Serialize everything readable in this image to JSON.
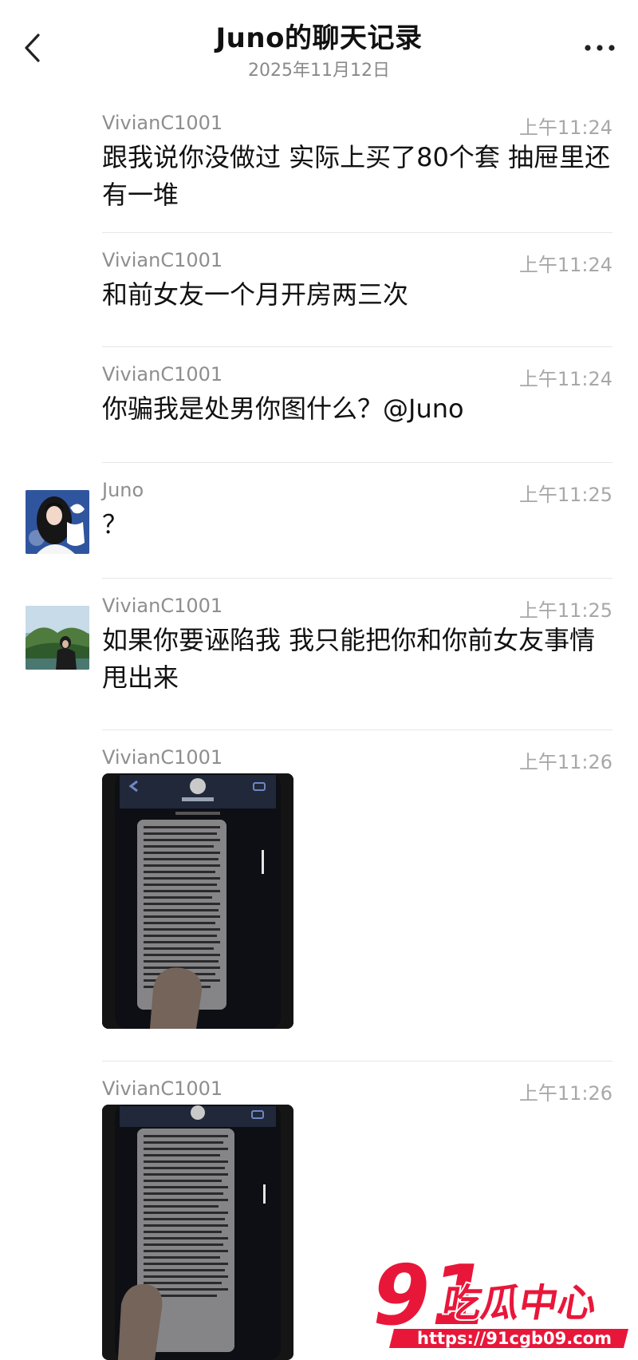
{
  "header": {
    "title": "Juno的聊天记录",
    "date": "2025年11月12日",
    "back_icon": "chevron-left-icon",
    "more_icon": "more-dots-icon"
  },
  "messages": [
    {
      "sender": "VivianC1001",
      "time": "上午11:24",
      "text": "跟我说你没做过 实际上买了80个套 抽屉里还有一堆"
    },
    {
      "sender": "VivianC1001",
      "time": "上午11:24",
      "text": "和前女友一个月开房两三次"
    },
    {
      "sender": "VivianC1001",
      "time": "上午11:24",
      "text": "你骗我是处男你图什么？@Juno"
    },
    {
      "sender": "Juno",
      "time": "上午11:25",
      "text": "？"
    },
    {
      "sender": "VivianC1001",
      "time": "上午11:25",
      "text": "如果你要诬陷我 我只能把你和你前女友事情甩出来"
    },
    {
      "sender": "VivianC1001",
      "time": "上午11:26",
      "image": "photo-of-phone-chat-screen"
    },
    {
      "sender": "VivianC1001",
      "time": "上午11:26",
      "image": "photo-of-phone-chat-screen"
    }
  ],
  "watermark": {
    "logo_text": "91吃瓜中心",
    "url": "https://91cgb09.com"
  },
  "colors": {
    "background": "#ffffff",
    "text_primary": "#111111",
    "name_gray": "#8e8e8e",
    "time_gray": "#a8a8a8",
    "divider": "#e6e6e6",
    "watermark_red": "#e8173a"
  }
}
